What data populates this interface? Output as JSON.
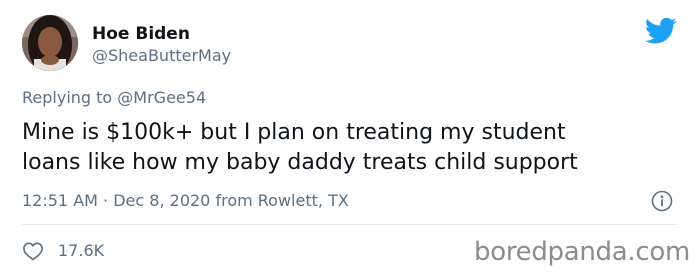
{
  "author": {
    "display_name": "Hoe Biden",
    "handle": "@SheaButterMay",
    "avatar": "profile-photo"
  },
  "brand_icon": "twitter-bird-icon",
  "reply": {
    "prefix": "Replying to",
    "mention": "@MrGee54"
  },
  "tweet": {
    "line1": "Mine is $100k+ but I plan on treating my student",
    "line2": "loans like how my baby daddy treats child support"
  },
  "meta": {
    "time": "12:51 AM",
    "separator": "·",
    "date": "Dec 8, 2020",
    "from_label": "from",
    "location": "Rowlett, TX"
  },
  "engagement": {
    "likes": "17.6K",
    "like_icon": "heart-icon"
  },
  "info_icon": "info-icon",
  "watermark": "boredpanda.com",
  "colors": {
    "twitter_blue": "#1da1f2",
    "secondary_text": "#5b7083",
    "primary_text": "#0f1419",
    "divider": "#e6ecf0",
    "watermark": "#8c8c8c"
  }
}
